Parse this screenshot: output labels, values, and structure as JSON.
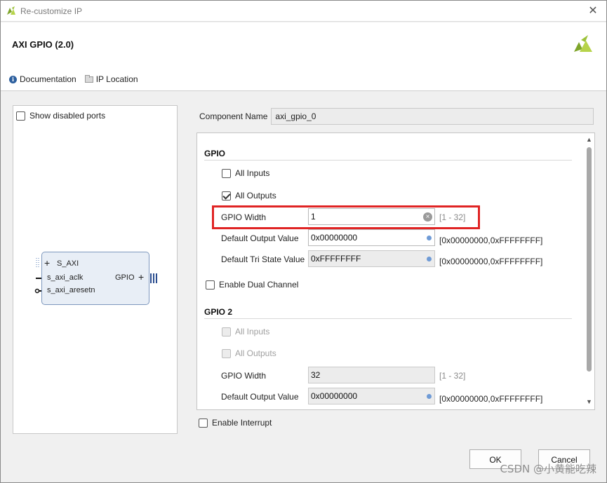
{
  "window": {
    "title": "Re-customize IP"
  },
  "header": {
    "ip_name": "AXI GPIO (2.0)",
    "links": {
      "documentation": "Documentation",
      "ip_location": "IP Location"
    }
  },
  "left_panel": {
    "show_disabled_ports_label": "Show disabled ports",
    "show_disabled_ports_checked": false,
    "block": {
      "ports_left": [
        "S_AXI",
        "s_axi_aclk",
        "s_axi_aresetn"
      ],
      "port_right": "GPIO"
    }
  },
  "component": {
    "label": "Component Name",
    "value": "axi_gpio_0"
  },
  "gpio": {
    "title": "GPIO",
    "all_inputs_label": "All Inputs",
    "all_inputs_checked": false,
    "all_outputs_label": "All Outputs",
    "all_outputs_checked": true,
    "width_label": "GPIO Width",
    "width_value": "1",
    "width_range": "[1 - 32]",
    "default_output_label": "Default Output Value",
    "default_output_value": "0x00000000",
    "default_output_range": "[0x00000000,0xFFFFFFFF]",
    "default_tri_label": "Default Tri State Value",
    "default_tri_value": "0xFFFFFFFF",
    "default_tri_range": "[0x00000000,0xFFFFFFFF]"
  },
  "dual_channel": {
    "label": "Enable Dual Channel",
    "checked": false
  },
  "gpio2": {
    "title": "GPIO 2",
    "all_inputs_label": "All Inputs",
    "all_outputs_label": "All Outputs",
    "width_label": "GPIO Width",
    "width_value": "32",
    "width_range": "[1 - 32]",
    "default_output_label": "Default Output Value",
    "default_output_value": "0x00000000",
    "default_output_range": "[0x00000000,0xFFFFFFFF]"
  },
  "interrupt": {
    "label": "Enable Interrupt",
    "checked": false
  },
  "buttons": {
    "ok": "OK",
    "cancel": "Cancel"
  },
  "watermark": "CSDN @小黄能吃辣",
  "colors": {
    "highlight": "#e02424",
    "brand": "#8cb82a",
    "block_fill": "#e8eef6",
    "block_border": "#7d97bd"
  }
}
